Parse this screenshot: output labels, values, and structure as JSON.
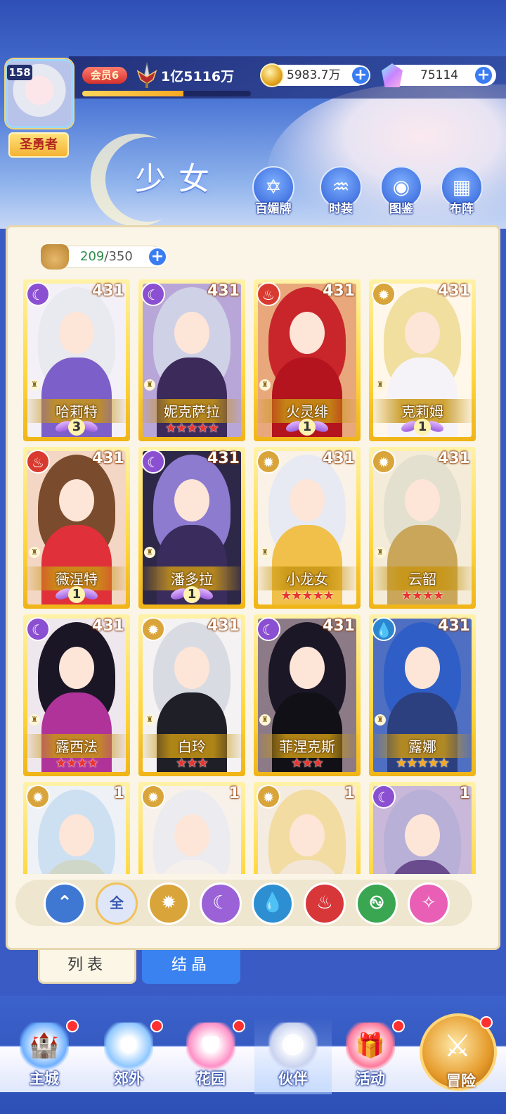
{
  "player": {
    "level": "158",
    "title": "圣勇者",
    "vip": "会员6",
    "power": "1亿5116万",
    "xp_fraction": 0.6
  },
  "currency": {
    "gold": "5983.7万",
    "gems": "75114"
  },
  "page": {
    "title": "少女"
  },
  "quick_actions": [
    {
      "label": "百媚牌",
      "icon": "hexagram-card-icon"
    },
    {
      "label": "时装",
      "icon": "costume-icon"
    },
    {
      "label": "图鉴",
      "icon": "book-icon"
    },
    {
      "label": "布阵",
      "icon": "grid-formation-icon"
    }
  ],
  "inventory": {
    "current": "209",
    "separator": "/",
    "max": "350"
  },
  "cards": [
    {
      "name": "哈莉特",
      "level": "431",
      "element": "moon",
      "rank": "wing",
      "wing_level": "3",
      "stars": "",
      "hair": "#e9e9f0",
      "outfit": "#7c5fc8",
      "bg": "#f3f0f8"
    },
    {
      "name": "妮克萨拉",
      "level": "431",
      "element": "moon",
      "rank": "stars",
      "wing_level": "",
      "stars": "★★★★★",
      "hair": "#cfd2e6",
      "outfit": "#3b2a5a",
      "bg": "#b9a6d8"
    },
    {
      "name": "火灵绯",
      "level": "431",
      "element": "fire",
      "rank": "wing",
      "wing_level": "1",
      "stars": "",
      "hair": "#c9262c",
      "outfit": "#b3141d",
      "bg": "#e9a87c"
    },
    {
      "name": "克莉姆",
      "level": "431",
      "element": "sun",
      "rank": "wing",
      "wing_level": "1",
      "stars": "",
      "hair": "#f1dfa0",
      "outfit": "#f6f3f8",
      "bg": "#fff7ea"
    },
    {
      "name": "薇涅特",
      "level": "431",
      "element": "fire",
      "rank": "wing",
      "wing_level": "1",
      "stars": "",
      "hair": "#7a4b2c",
      "outfit": "#e0303a",
      "bg": "#f3d6c4"
    },
    {
      "name": "潘多拉",
      "level": "431",
      "element": "moon",
      "rank": "wing",
      "wing_level": "1",
      "stars": "",
      "hair": "#8d7bd0",
      "outfit": "#3a2c5c",
      "bg": "#2e2848"
    },
    {
      "name": "小龙女",
      "level": "431",
      "element": "sun",
      "rank": "stars",
      "wing_level": "",
      "stars": "★★★★★",
      "hair": "#e7eaf2",
      "outfit": "#f0c04a",
      "bg": "#faf2e6"
    },
    {
      "name": "云韶",
      "level": "431",
      "element": "sun",
      "rank": "stars",
      "wing_level": "",
      "stars": "★★★★",
      "hair": "#e3e0d0",
      "outfit": "#c9a65a",
      "bg": "#f4ecd8"
    },
    {
      "name": "露西法",
      "level": "431",
      "element": "moon",
      "rank": "stars",
      "wing_level": "",
      "stars": "★★★★",
      "hair": "#1b1626",
      "outfit": "#b0339a",
      "bg": "#efe7ee"
    },
    {
      "name": "白玲",
      "level": "431",
      "element": "sun",
      "rank": "stars",
      "wing_level": "",
      "stars": "★★★",
      "hair": "#d9dbe3",
      "outfit": "#1f1f28",
      "bg": "#f4f2f2"
    },
    {
      "name": "菲涅克斯",
      "level": "431",
      "element": "moon",
      "rank": "stars",
      "wing_level": "",
      "stars": "★★★",
      "hair": "#1b1726",
      "outfit": "#111016",
      "bg": "#8c7b86"
    },
    {
      "name": "露娜",
      "level": "431",
      "element": "water",
      "rank": "stars_gold",
      "wing_level": "",
      "stars": "★★★★★",
      "hair": "#2f5fc6",
      "outfit": "#2c3f7e",
      "bg": "#4f6fc2"
    },
    {
      "name": "",
      "level": "1",
      "element": "sun",
      "rank": "none",
      "wing_level": "",
      "stars": "",
      "hair": "#cde0f1",
      "outfit": "#cfd7c8",
      "bg": "#eef2f6"
    },
    {
      "name": "",
      "level": "1",
      "element": "sun",
      "rank": "none",
      "wing_level": "",
      "stars": "",
      "hair": "#ececf0",
      "outfit": "#f6f0ec",
      "bg": "#f7f1ea"
    },
    {
      "name": "",
      "level": "1",
      "element": "sun",
      "rank": "none",
      "wing_level": "",
      "stars": "",
      "hair": "#f2dca2",
      "outfit": "#f3e6d6",
      "bg": "#f5ece1"
    },
    {
      "name": "",
      "level": "1",
      "element": "moon",
      "rank": "none",
      "wing_level": "",
      "stars": "",
      "hair": "#b8b0d6",
      "outfit": "#6a4c8e",
      "bg": "#c9b8da"
    }
  ],
  "filters": [
    {
      "key": "wind-arrow",
      "glyph": "⌃",
      "color": "#3f78d3"
    },
    {
      "key": "all",
      "glyph": "全",
      "color": "#dfe6f7"
    },
    {
      "key": "sun",
      "glyph": "✹",
      "color": "#d9a43a"
    },
    {
      "key": "moon",
      "glyph": "☾",
      "color": "#9b62d8"
    },
    {
      "key": "water",
      "glyph": "💧",
      "color": "#2d8fd1"
    },
    {
      "key": "fire",
      "glyph": "♨",
      "color": "#d8373a"
    },
    {
      "key": "wind",
      "glyph": "࿊",
      "color": "#3aa652"
    },
    {
      "key": "star",
      "glyph": "✧",
      "color": "#e95fb6"
    }
  ],
  "tabs": [
    {
      "label": "列表"
    },
    {
      "label": "结晶"
    }
  ],
  "nav": [
    {
      "label": "主城",
      "icon": "castle-icon",
      "badge": true
    },
    {
      "label": "郊外",
      "icon": "portal-icon",
      "badge": true
    },
    {
      "label": "花园",
      "icon": "heart-garden-icon",
      "badge": true
    },
    {
      "label": "伙伴",
      "icon": "partner-portrait-icon",
      "badge": false
    },
    {
      "label": "活动",
      "icon": "gift-box-icon",
      "badge": true
    },
    {
      "label": "冒险",
      "icon": "sword-adventure-icon",
      "badge": true
    }
  ],
  "colors": {
    "accent": "#3a7cf2",
    "card_gold": "#ffd63a",
    "star_red": "#e8342f",
    "star_gold": "#f5a81d"
  }
}
